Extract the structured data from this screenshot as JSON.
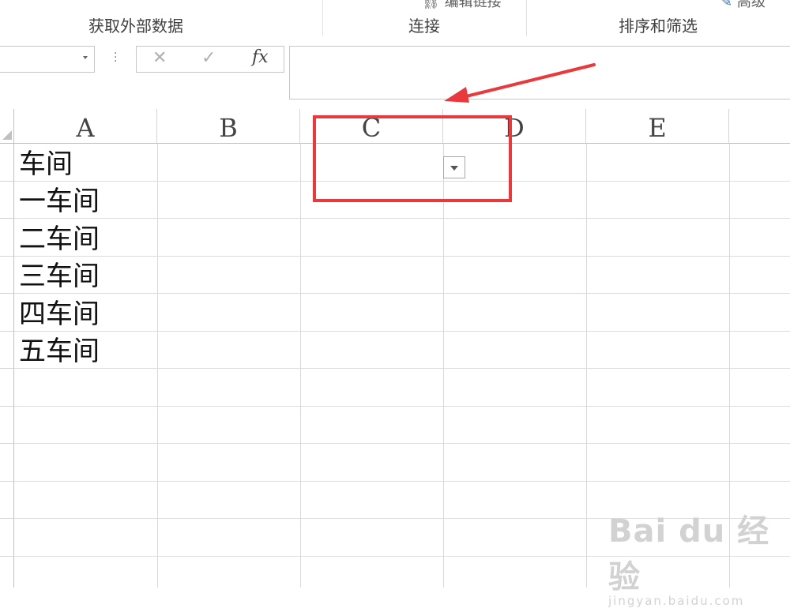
{
  "ribbon": {
    "groups": [
      {
        "label": "获取外部数据"
      },
      {
        "label": "连接"
      },
      {
        "label": "排序和筛选"
      }
    ],
    "partial_top_left": "编辑链接",
    "partial_top_right": "高级"
  },
  "formula_bar": {
    "name_box_value": "",
    "cancel_icon": "✕",
    "enter_icon": "✓",
    "fx_label": "fx",
    "formula_value": ""
  },
  "sheet": {
    "columns": [
      "A",
      "B",
      "C",
      "D",
      "E"
    ],
    "cells_A": [
      "车间",
      "一车间",
      "二车间",
      "三车间",
      "四车间",
      "五车间"
    ]
  },
  "watermark": {
    "brand": "Bai du 经验",
    "url": "jingyan.baidu.com"
  },
  "colors": {
    "annotation_red": "#e8393d"
  }
}
